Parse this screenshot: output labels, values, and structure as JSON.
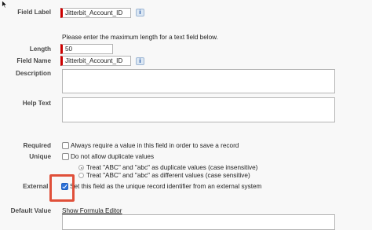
{
  "form": {
    "field_label": {
      "label": "Field Label",
      "value": "Jitterbit_Account_ID",
      "info_icon": "info-icon"
    },
    "length_hint": "Please enter the maximum length for a text field below.",
    "length": {
      "label": "Length",
      "value": "50"
    },
    "field_name": {
      "label": "Field Name",
      "value": "Jitterbit_Account_ID",
      "info_icon": "info-icon"
    },
    "description": {
      "label": "Description",
      "value": ""
    },
    "help_text": {
      "label": "Help Text",
      "value": ""
    },
    "required": {
      "label": "Required",
      "text": "Always require a value in this field in order to save a record",
      "checked": false
    },
    "unique": {
      "label": "Unique",
      "text": "Do not allow duplicate values",
      "checked": false,
      "options": [
        "Treat \"ABC\" and \"abc\" as duplicate values (case insensitive)",
        "Treat \"ABC\" and \"abc\" as different values (case sensitive)"
      ]
    },
    "external_id": {
      "label": "External ID",
      "label_visible": "External I",
      "text": "Set this field as the unique record identifier from an external system",
      "text_visible": "Set this field as the unique record identifier from an external system",
      "checked": true
    },
    "default_value": {
      "label": "Default Value",
      "link": "Show Formula Editor"
    }
  },
  "colors": {
    "required_bar": "#cc0000",
    "highlight": "#e0503a",
    "checkbox_checked": "#2d72d9"
  }
}
